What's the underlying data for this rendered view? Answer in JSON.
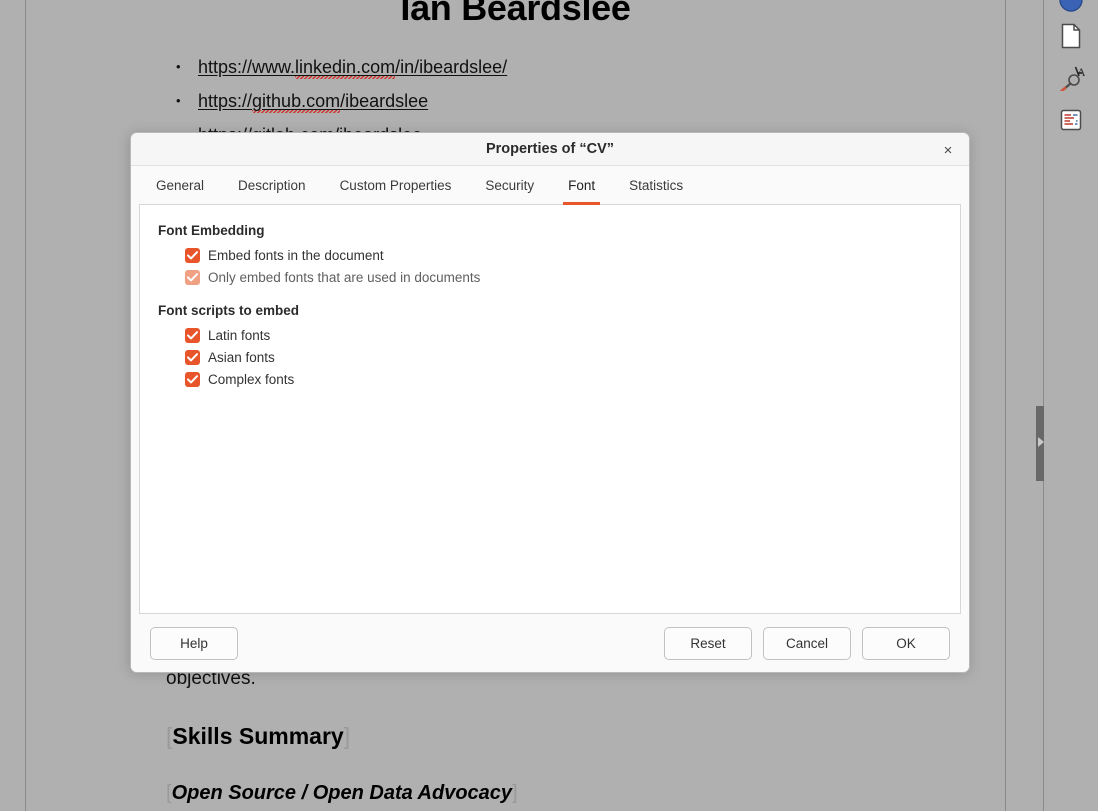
{
  "document": {
    "title": "Ian Beardslee",
    "links": [
      {
        "prefix": "https://www.",
        "spell": "linkedin.com",
        "suffix": "/in/ibeardslee/"
      },
      {
        "prefix": "https://",
        "spell": "github.com",
        "suffix": "/ibeardslee"
      },
      {
        "prefix": "https://",
        "spell": "gitlab.com",
        "suffix": "/ibeardslee"
      }
    ],
    "paragraph_fragment": "objectives.",
    "heading_skills": "Skills Summary",
    "heading_advocacy": "Open Source / Open Data Advocacy",
    "bookmark_open": "[",
    "bookmark_close": "]"
  },
  "sidebar": {
    "items": [
      {
        "name": "properties-deck",
        "label": "Properties"
      },
      {
        "name": "page-deck",
        "label": "Page"
      },
      {
        "name": "style-inspector-deck",
        "label": "Style Inspector"
      },
      {
        "name": "manage-changes-deck",
        "label": "Manage Changes"
      }
    ]
  },
  "dialog": {
    "title": "Properties of “CV”",
    "close_label": "×",
    "tabs": [
      {
        "label": "General",
        "active": false
      },
      {
        "label": "Description",
        "active": false
      },
      {
        "label": "Custom Properties",
        "active": false
      },
      {
        "label": "Security",
        "active": false
      },
      {
        "label": "Font",
        "active": true
      },
      {
        "label": "Statistics",
        "active": false
      }
    ],
    "active_tab": "Font",
    "accent_color": "#e8552a",
    "sections": [
      {
        "heading": "Font Embedding",
        "checkboxes": [
          {
            "label": "Embed fonts in the document",
            "checked": true,
            "dim": false
          },
          {
            "label": "Only embed fonts that are used in documents",
            "checked": true,
            "dim": true
          }
        ]
      },
      {
        "heading": "Font scripts to embed",
        "checkboxes": [
          {
            "label": "Latin fonts",
            "checked": true,
            "dim": false
          },
          {
            "label": "Asian fonts",
            "checked": true,
            "dim": false
          },
          {
            "label": "Complex fonts",
            "checked": true,
            "dim": false
          }
        ]
      }
    ],
    "buttons": {
      "help": "Help",
      "reset": "Reset",
      "cancel": "Cancel",
      "ok": "OK"
    }
  }
}
